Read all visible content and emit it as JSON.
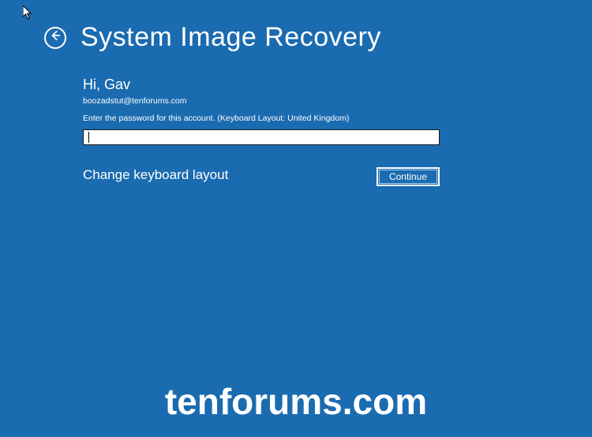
{
  "header": {
    "title": "System Image Recovery"
  },
  "account": {
    "greeting": "Hi, Gav",
    "email": "boozadstut@tenforums.com",
    "password_prompt": "Enter the password for this account. (Keyboard Layout: United Kingdom)",
    "password_value": ""
  },
  "actions": {
    "change_layout": "Change keyboard layout",
    "continue": "Continue"
  },
  "watermark": "tenforums.com"
}
